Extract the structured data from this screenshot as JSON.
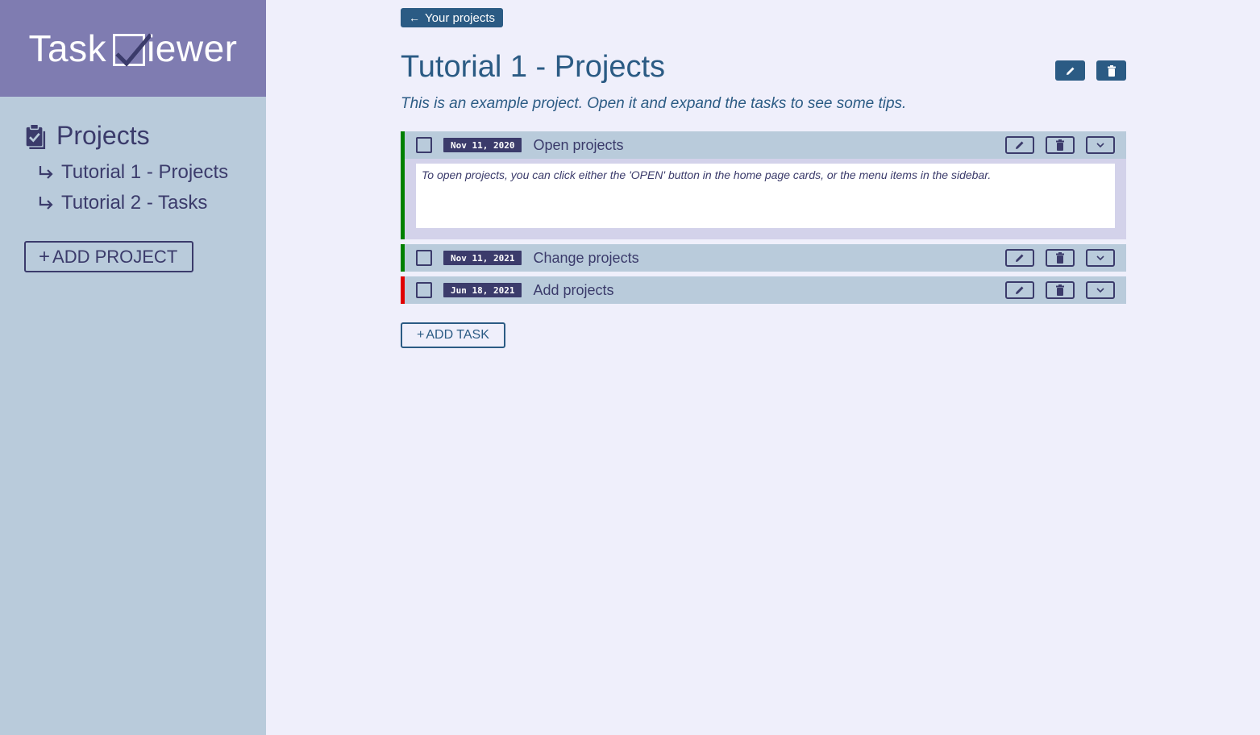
{
  "app": {
    "logo_left": "Task",
    "logo_right": "iewer"
  },
  "sidebar": {
    "heading": "Projects",
    "items": [
      {
        "label": "Tutorial 1 - Projects"
      },
      {
        "label": "Tutorial 2 - Tasks"
      }
    ],
    "add_project_label": "ADD PROJECT",
    "add_symbol": "+"
  },
  "main": {
    "back_label": "Your projects",
    "title": "Tutorial 1 - Projects",
    "description": "This is an example project. Open it and expand the tasks to see some tips.",
    "tasks": [
      {
        "date": "Nov 11, 2020",
        "title": "Open projects",
        "status_color": "#008000",
        "expanded": true,
        "note": "To open projects, you can click either the 'OPEN' button in the home page cards, or the menu items in the sidebar."
      },
      {
        "date": "Nov 11, 2021",
        "title": "Change projects",
        "status_color": "#008000",
        "expanded": false
      },
      {
        "date": "Jun 18, 2021",
        "title": "Add projects",
        "status_color": "#e00000",
        "expanded": false
      }
    ],
    "add_task_label": "ADD TASK",
    "add_symbol": "+"
  },
  "colors": {
    "sidebar_bg": "#b9cbdb",
    "logo_bg": "#7f7cb1",
    "page_bg": "#efeffb",
    "primary": "#2b5b84",
    "dark": "#3b3b6b"
  }
}
